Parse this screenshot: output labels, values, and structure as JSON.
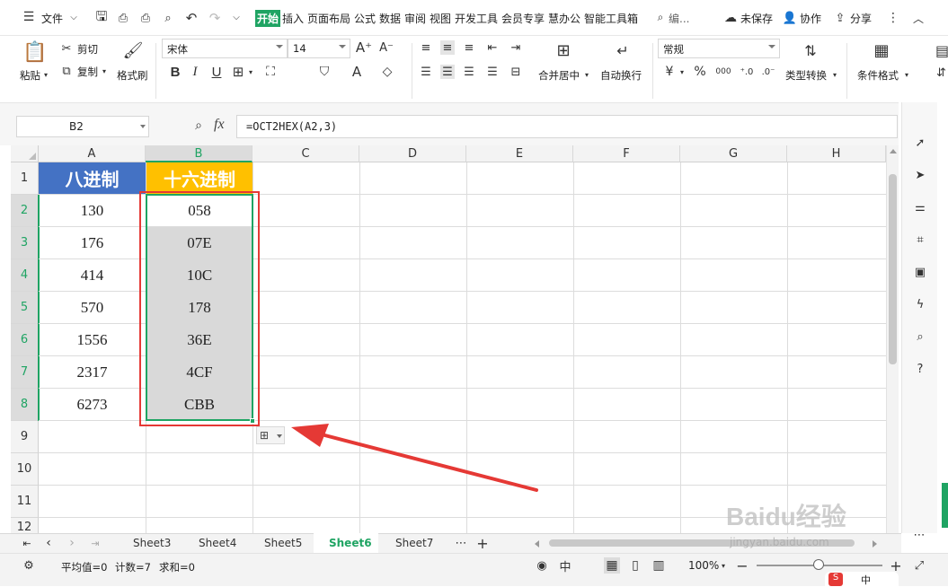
{
  "menu": {
    "file": "文件",
    "tabs": [
      "开始",
      "插入",
      "页面布局",
      "公式",
      "数据",
      "审阅",
      "视图",
      "开发工具",
      "会员专享",
      "慧办公",
      "智能工具箱"
    ],
    "search": "编...",
    "unsaved": "未保存",
    "collab": "协作",
    "share": "分享"
  },
  "ribbon": {
    "paste": "粘贴",
    "cut": "剪切",
    "copy": "复制",
    "format_painter": "格式刷",
    "font_name": "宋体",
    "font_size": "14",
    "bold": "B",
    "italic": "I",
    "underline": "U",
    "merge_center": "合并居中",
    "wrap_text": "自动换行",
    "number_format": "常规",
    "currency": "¥",
    "percent": "%",
    "thousands": "000",
    "type_convert": "类型转换",
    "cond_format": "条件格式"
  },
  "formula_bar": {
    "name_box": "B2",
    "fx": "fx",
    "formula": "=OCT2HEX(A2,3)"
  },
  "columns": [
    "A",
    "B",
    "C",
    "D",
    "E",
    "F",
    "G",
    "H"
  ],
  "rows": [
    "1",
    "2",
    "3",
    "4",
    "5",
    "6",
    "7",
    "8",
    "9",
    "10",
    "11",
    "12"
  ],
  "table": {
    "header_a": "八进制",
    "header_b": "十六进制",
    "octal": [
      "130",
      "176",
      "414",
      "570",
      "1556",
      "2317",
      "6273"
    ],
    "hex": [
      "058",
      "07E",
      "10C",
      "178",
      "36E",
      "4CF",
      "CBB"
    ]
  },
  "sheets": [
    "Sheet3",
    "Sheet4",
    "Sheet5",
    "Sheet6",
    "Sheet7"
  ],
  "active_sheet": "Sheet6",
  "status": {
    "average": "平均值=0",
    "count": "计数=7",
    "sum": "求和=0",
    "zoom": "100%"
  },
  "watermark": {
    "text": "Baidu经验",
    "url": "jingyan.baidu.com"
  },
  "colors": {
    "accent_green": "#1fa463",
    "header_blue": "#4472c4",
    "header_orange": "#ffc000",
    "selection_fill": "#d9d9d9",
    "red_outline": "#e53935"
  }
}
